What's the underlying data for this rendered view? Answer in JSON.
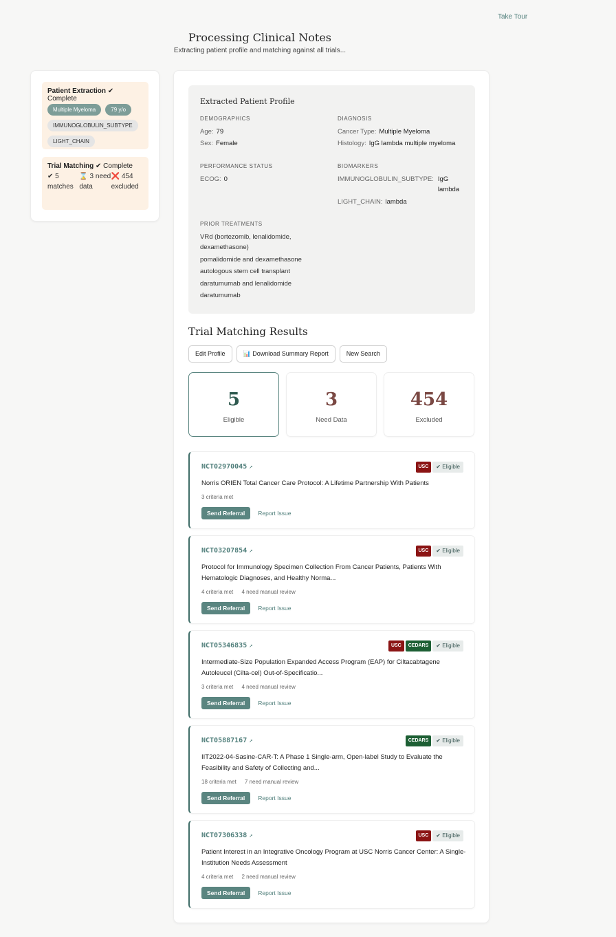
{
  "header": {
    "take_tour": "Take Tour",
    "title": "Processing Clinical Notes",
    "subtitle": "Extracting patient profile and matching against all trials..."
  },
  "progress": {
    "extraction": {
      "label": "Patient Extraction",
      "status": "✔ Complete",
      "chips": [
        "Multiple Myeloma",
        "79 y/o",
        "IMMUNOGLOBULIN_SUBTYPE",
        "LIGHT_CHAIN"
      ]
    },
    "matching": {
      "label": "Trial Matching",
      "status": "✔ Complete",
      "matches": "✔ 5 matches",
      "need_data": "⌛ 3 need data",
      "excluded_icon": "❌",
      "excluded": "454 excluded"
    }
  },
  "profile": {
    "title": "Extracted Patient Profile",
    "demographics": {
      "heading": "DEMOGRAPHICS",
      "age_label": "Age:",
      "age": "79",
      "sex_label": "Sex:",
      "sex": "Female"
    },
    "diagnosis": {
      "heading": "DIAGNOSIS",
      "cancer_label": "Cancer Type:",
      "cancer": "Multiple Myeloma",
      "histology_label": "Histology:",
      "histology": "IgG lambda multiple myeloma"
    },
    "performance": {
      "heading": "PERFORMANCE STATUS",
      "ecog_label": "ECOG:",
      "ecog": "0"
    },
    "biomarkers": {
      "heading": "BIOMARKERS",
      "ig_label": "IMMUNOGLOBULIN_SUBTYPE:",
      "ig": "IgG lambda",
      "lc_label": "LIGHT_CHAIN:",
      "lc": "lambda"
    },
    "treatments": {
      "heading": "PRIOR TREATMENTS",
      "items": [
        "VRd (bortezomib, lenalidomide, dexamethasone)",
        "pomalidomide and dexamethasone",
        "autologous stem cell transplant",
        "daratumumab and lenalidomide",
        "daratumumab"
      ]
    }
  },
  "results": {
    "title": "Trial Matching Results",
    "buttons": {
      "edit": "Edit Profile",
      "download": "📊 Download Summary Report",
      "new_search": "New Search"
    },
    "summary": [
      {
        "num": "5",
        "label": "Eligible",
        "color": "#2f5a4f"
      },
      {
        "num": "3",
        "label": "Need Data",
        "color": "#7a4843"
      },
      {
        "num": "454",
        "label": "Excluded",
        "color": "#7a4843"
      }
    ],
    "trials": [
      {
        "id": "NCT02970045",
        "ext": "↗",
        "badges": [
          "USC"
        ],
        "status": "✔ Eligible",
        "title": "Norris ORIEN Total Cancer Care Protocol: A Lifetime Partnership With Patients",
        "criteria": "3 criteria met",
        "review": "",
        "send": "Send Referral",
        "report": "Report Issue"
      },
      {
        "id": "NCT03207854",
        "ext": "↗",
        "badges": [
          "USC"
        ],
        "status": "✔ Eligible",
        "title": "Protocol for Immunology Specimen Collection From Cancer Patients, Patients With Hematologic Diagnoses, and Healthy Norma...",
        "criteria": "4 criteria met",
        "review": "4 need manual review",
        "send": "Send Referral",
        "report": "Report Issue"
      },
      {
        "id": "NCT05346835",
        "ext": "↗",
        "badges": [
          "USC",
          "CEDARS"
        ],
        "status": "✔ Eligible",
        "title": "Intermediate-Size Population Expanded Access Program (EAP) for Ciltacabtagene Autoleucel (Cilta-cel) Out-of-Specificatio...",
        "criteria": "3 criteria met",
        "review": "4 need manual review",
        "send": "Send Referral",
        "report": "Report Issue"
      },
      {
        "id": "NCT05887167",
        "ext": "↗",
        "badges": [
          "CEDARS"
        ],
        "status": "✔ Eligible",
        "title": "IIT2022-04-Sasine-CAR-T: A Phase 1 Single-arm, Open-label Study to Evaluate the Feasibility and Safety of Collecting and...",
        "criteria": "18 criteria met",
        "review": "7 need manual review",
        "send": "Send Referral",
        "report": "Report Issue"
      },
      {
        "id": "NCT07306338",
        "ext": "↗",
        "badges": [
          "USC"
        ],
        "status": "✔ Eligible",
        "title": "Patient Interest in an Integrative Oncology Program at USC Norris Cancer Center: A Single-Institution Needs Assessment",
        "criteria": "4 criteria met",
        "review": "2 need manual review",
        "send": "Send Referral",
        "report": "Report Issue"
      }
    ]
  }
}
